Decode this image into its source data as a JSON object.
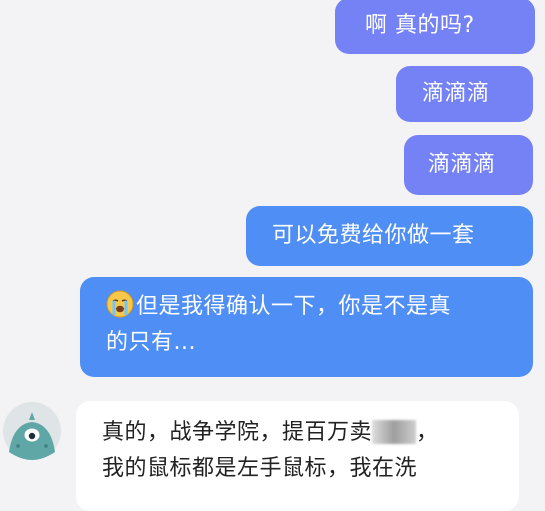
{
  "chat": {
    "messages": [
      {
        "text": "啊  真的吗?"
      },
      {
        "text": "滴滴滴"
      },
      {
        "text": "滴滴滴"
      },
      {
        "text": "可以免费给你做一套"
      },
      {
        "emoji": "crying-face-icon",
        "line1": "但是我得确认一下，你是不是真",
        "line2": "的只有..."
      },
      {
        "line1_a": "真的，战争学院，提百万卖",
        "line1_b": "，",
        "line2": "我的鼠标都是左手鼠标，我在洗"
      }
    ],
    "avatar": {
      "icon": "teal-monster-avatar-icon"
    }
  },
  "colors": {
    "background": "#f3f3f5",
    "bubble_me": "#7582f5",
    "bubble_me_blue": "#4f8ef5",
    "bubble_them": "#ffffff"
  }
}
